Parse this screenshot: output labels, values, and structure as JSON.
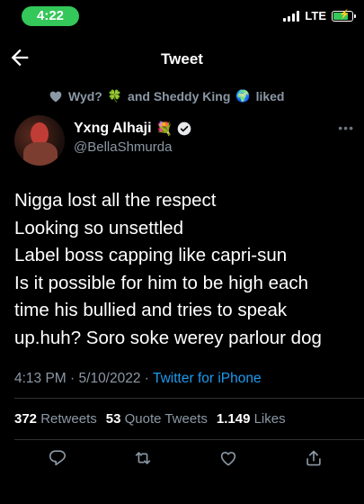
{
  "status_bar": {
    "time": "4:22",
    "network": "LTE",
    "battery_charging": true
  },
  "nav": {
    "title": "Tweet",
    "back_icon": "arrow-left-icon"
  },
  "social_context": {
    "user1": "Wyd?",
    "emoji1": "🍀",
    "text": "and Sheddy King",
    "emoji2": "🌍",
    "action": "liked"
  },
  "author": {
    "display_name": "Yxng Alhaji",
    "name_emoji": "💐",
    "handle": "@BellaShmurda",
    "verified": true
  },
  "tweet": {
    "lines": [
      "Nigga lost all the respect",
      "Looking so unsettled",
      "Label boss capping like capri-sun",
      "Is it possible for him to be high each",
      "time his bullied and tries to speak",
      "up.huh? Soro soke werey parlour dog"
    ],
    "time": "4:13 PM",
    "date": "5/10/2022",
    "source": "Twitter for iPhone"
  },
  "stats": {
    "retweets": "372",
    "retweets_label": "Retweets",
    "quotes": "53",
    "quotes_label": "Quote Tweets",
    "likes": "1.149",
    "likes_label": "Likes"
  },
  "colors": {
    "accent": "#1d9bf0",
    "secondary_text": "#8b98a5",
    "background": "#000000",
    "divider": "#2f3336"
  }
}
